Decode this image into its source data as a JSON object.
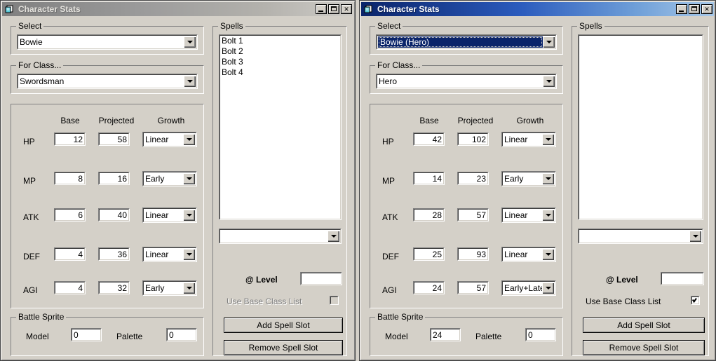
{
  "windows": [
    {
      "id": "left",
      "active": false,
      "title": "Character Stats",
      "icon": "character-stats-icon",
      "titlebar_buttons": {
        "minimize": "minimize-button",
        "maximize": "maximize-button",
        "close": "close-button",
        "close_glyph": "✕"
      },
      "select_group": {
        "label": "Select",
        "value": "Bowie",
        "selected": false
      },
      "class_group": {
        "label": "For Class...",
        "value": "Swordsman"
      },
      "stats": {
        "headers": {
          "base": "Base",
          "projected": "Projected",
          "growth": "Growth"
        },
        "rows": [
          {
            "name": "HP",
            "base": "12",
            "projected": "58",
            "growth": "Linear"
          },
          {
            "name": "MP",
            "base": "8",
            "projected": "16",
            "growth": "Early"
          },
          {
            "name": "ATK",
            "base": "6",
            "projected": "40",
            "growth": "Linear"
          },
          {
            "name": "DEF",
            "base": "4",
            "projected": "36",
            "growth": "Linear"
          },
          {
            "name": "AGI",
            "base": "4",
            "projected": "32",
            "growth": "Early"
          }
        ]
      },
      "battle_sprite": {
        "label": "Battle Sprite",
        "model_label": "Model",
        "model_value": "0",
        "palette_label": "Palette",
        "palette_value": "0"
      },
      "spells": {
        "label": "Spells",
        "items": [
          "Bolt 1",
          "Bolt 2",
          "Bolt 3",
          "Bolt 4"
        ],
        "spell_combo_value": "",
        "level_label": "@ Level",
        "level_value": "",
        "use_base_class_label": "Use Base Class List",
        "use_base_class_checked": false,
        "use_base_class_disabled": true,
        "add_button": "Add Spell Slot",
        "remove_button": "Remove Spell Slot"
      }
    },
    {
      "id": "right",
      "active": true,
      "title": "Character Stats",
      "icon": "character-stats-icon",
      "titlebar_buttons": {
        "minimize": "minimize-button",
        "maximize": "maximize-button",
        "close": "close-button",
        "close_glyph": "✕"
      },
      "select_group": {
        "label": "Select",
        "value": "Bowie (Hero)",
        "selected": true
      },
      "class_group": {
        "label": "For Class...",
        "value": "Hero"
      },
      "stats": {
        "headers": {
          "base": "Base",
          "projected": "Projected",
          "growth": "Growth"
        },
        "rows": [
          {
            "name": "HP",
            "base": "42",
            "projected": "102",
            "growth": "Linear"
          },
          {
            "name": "MP",
            "base": "14",
            "projected": "23",
            "growth": "Early"
          },
          {
            "name": "ATK",
            "base": "28",
            "projected": "57",
            "growth": "Linear"
          },
          {
            "name": "DEF",
            "base": "25",
            "projected": "93",
            "growth": "Linear"
          },
          {
            "name": "AGI",
            "base": "24",
            "projected": "57",
            "growth": "Early+Late"
          }
        ]
      },
      "battle_sprite": {
        "label": "Battle Sprite",
        "model_label": "Model",
        "model_value": "24",
        "palette_label": "Palette",
        "palette_value": "0"
      },
      "spells": {
        "label": "Spells",
        "items": [],
        "spell_combo_value": "",
        "level_label": "@ Level",
        "level_value": "",
        "use_base_class_label": "Use Base Class List",
        "use_base_class_checked": true,
        "use_base_class_disabled": false,
        "add_button": "Add Spell Slot",
        "remove_button": "Remove Spell Slot"
      }
    }
  ],
  "colors": {
    "face": "#d4d0c8",
    "active_title_start": "#0a246a",
    "active_title_end": "#a8c9e9",
    "inactive_title_start": "#7f7f7f",
    "inactive_title_end": "#cfcdc8",
    "selection": "#0a246a",
    "disabled_text": "#808080"
  }
}
